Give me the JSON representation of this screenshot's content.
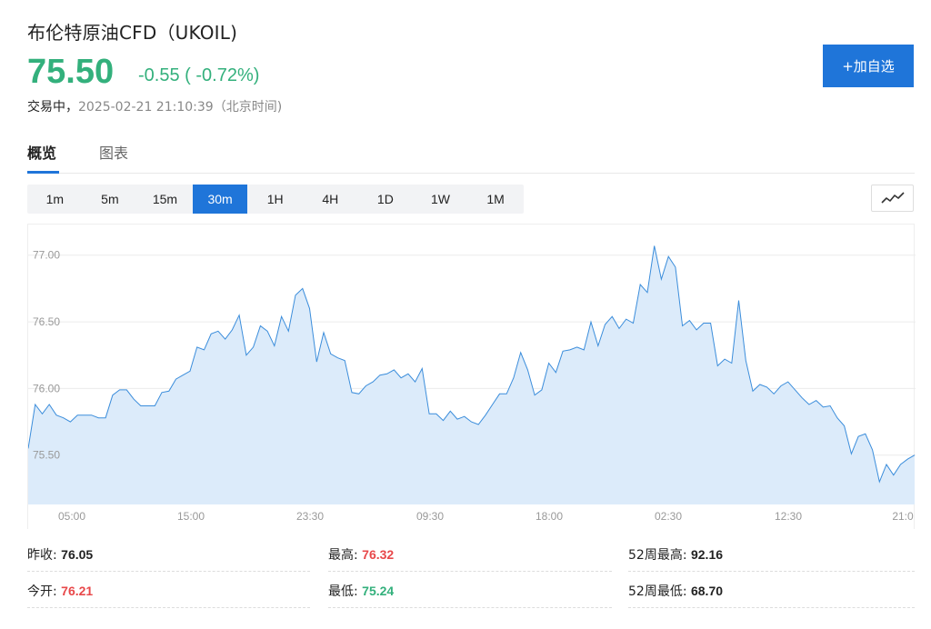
{
  "header": {
    "title": "布伦特原油CFD（UKOIL)",
    "price": "75.50",
    "change": "-0.55 ( -0.72%)",
    "status_label": "交易中，",
    "timestamp": "2025-02-21 21:10:39（北京时间)",
    "add_button": "+加自选"
  },
  "tabs": [
    {
      "label": "概览",
      "active": true
    },
    {
      "label": "图表",
      "active": false
    }
  ],
  "intervals": [
    {
      "label": "1m",
      "active": false
    },
    {
      "label": "5m",
      "active": false
    },
    {
      "label": "15m",
      "active": false
    },
    {
      "label": "30m",
      "active": true
    },
    {
      "label": "1H",
      "active": false
    },
    {
      "label": "4H",
      "active": false
    },
    {
      "label": "1D",
      "active": false
    },
    {
      "label": "1W",
      "active": false
    },
    {
      "label": "1M",
      "active": false
    }
  ],
  "chart_type_icon": "line-chart-icon",
  "colors": {
    "up": "#e8484a",
    "down": "#33b07c",
    "accent": "#1f75d9",
    "line": "#3b8ddb",
    "fill": "#dcebfa"
  },
  "stats": [
    {
      "label": "昨收:",
      "value": "76.05",
      "tone": "neutral"
    },
    {
      "label": "最高:",
      "value": "76.32",
      "tone": "up"
    },
    {
      "label": "52周最高:",
      "value": "92.16",
      "tone": "neutral"
    },
    {
      "label": "今开:",
      "value": "76.21",
      "tone": "up"
    },
    {
      "label": "最低:",
      "value": "75.24",
      "tone": "down"
    },
    {
      "label": "52周最低:",
      "value": "68.70",
      "tone": "neutral"
    }
  ],
  "chart_data": {
    "type": "area",
    "x_tick_labels": [
      "05:00",
      "15:00",
      "23:30",
      "09:30",
      "18:00",
      "02:30",
      "12:30",
      "21:0"
    ],
    "y_tick_labels": [
      "77.00",
      "76.50",
      "76.00",
      "75.50"
    ],
    "ylim": [
      75.13,
      77.23
    ],
    "grid": true,
    "values": [
      75.55,
      75.88,
      75.81,
      75.88,
      75.8,
      75.78,
      75.75,
      75.8,
      75.8,
      75.8,
      75.78,
      75.78,
      75.95,
      75.99,
      75.99,
      75.92,
      75.87,
      75.87,
      75.87,
      75.97,
      75.98,
      76.07,
      76.1,
      76.13,
      76.31,
      76.29,
      76.41,
      76.43,
      76.37,
      76.44,
      76.55,
      76.25,
      76.31,
      76.47,
      76.43,
      76.32,
      76.54,
      76.43,
      76.7,
      76.75,
      76.6,
      76.2,
      76.42,
      76.26,
      76.23,
      76.21,
      75.97,
      75.96,
      76.02,
      76.05,
      76.1,
      76.11,
      76.14,
      76.08,
      76.11,
      76.05,
      76.15,
      75.81,
      75.81,
      75.76,
      75.83,
      75.77,
      75.79,
      75.75,
      75.73,
      75.8,
      75.88,
      75.96,
      75.96,
      76.08,
      76.27,
      76.14,
      75.95,
      75.99,
      76.19,
      76.12,
      76.28,
      76.29,
      76.31,
      76.29,
      76.5,
      76.32,
      76.48,
      76.54,
      76.45,
      76.52,
      76.49,
      76.78,
      76.72,
      77.07,
      76.82,
      76.99,
      76.91,
      76.47,
      76.51,
      76.44,
      76.49,
      76.49,
      76.17,
      76.22,
      76.19,
      76.66,
      76.21,
      75.98,
      76.03,
      76.01,
      75.96,
      76.02,
      76.05,
      75.99,
      75.93,
      75.88,
      75.91,
      75.86,
      75.87,
      75.78,
      75.72,
      75.51,
      75.64,
      75.66,
      75.54,
      75.3,
      75.43,
      75.35,
      75.43,
      75.47,
      75.5
    ]
  }
}
